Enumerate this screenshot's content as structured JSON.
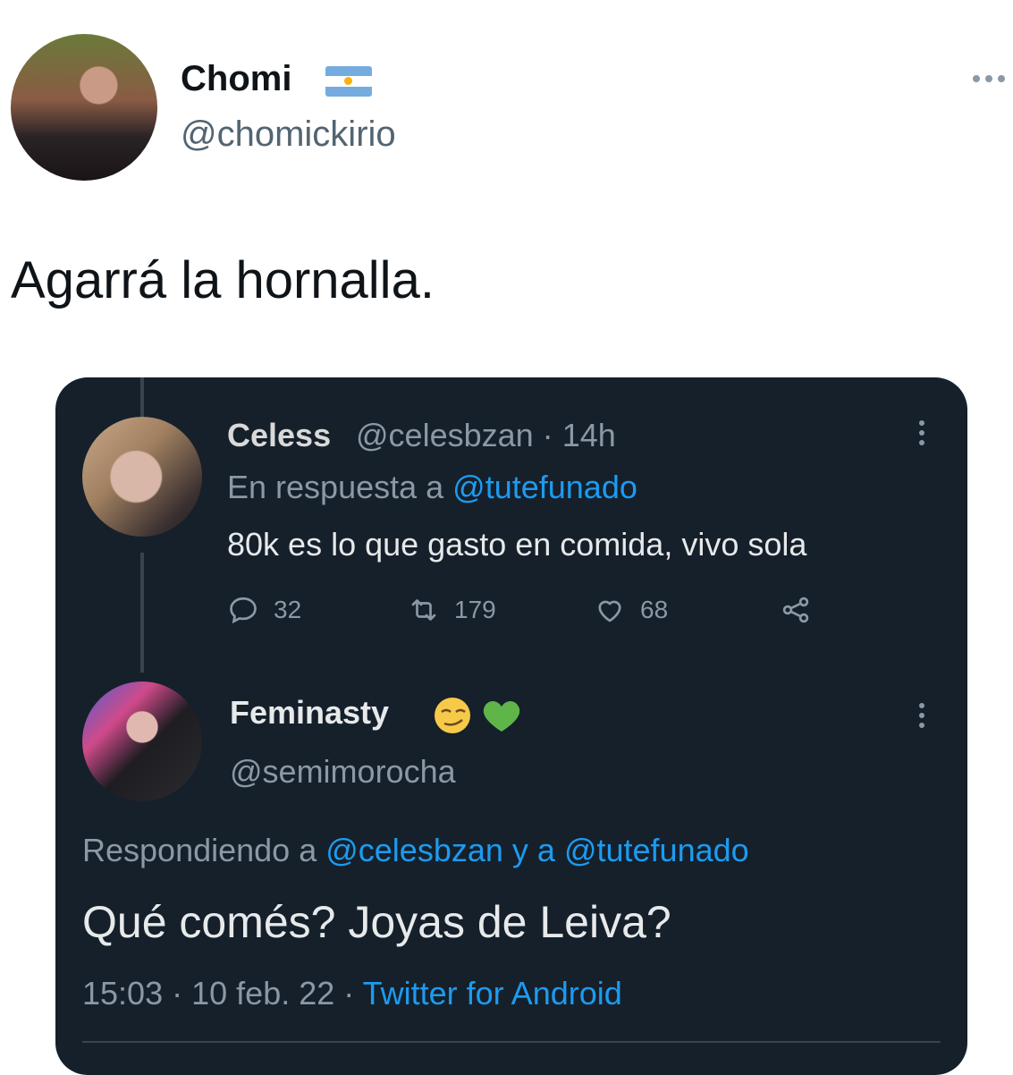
{
  "author": {
    "name": "Chomi",
    "handle": "@chomickirio",
    "flag_icon": "argentina-flag-icon"
  },
  "tweet": {
    "text": "Agarrá la hornalla."
  },
  "embedded": {
    "reply_tweet": {
      "name": "Celess",
      "handle": "@celesbzan",
      "time": "14h",
      "in_reply_label": "En respuesta a",
      "in_reply_to": "@tutefunado",
      "text": "80k es lo que gasto en comida, vivo sola",
      "replies": "32",
      "retweets": "179",
      "likes": "68"
    },
    "main_tweet": {
      "name": "Feminasty",
      "name_emojis": [
        "smirking-face-icon",
        "green-heart-icon"
      ],
      "handle": "@semimorocha",
      "replying_label": "Respondiendo a",
      "replying_to_1": "@celesbzan",
      "replying_conj": "y a",
      "replying_to_2": "@tutefunado",
      "text": "Qué comés? Joyas de Leiva?",
      "time": "15:03",
      "date": "10 feb. 22",
      "source": "Twitter for Android"
    }
  },
  "colors": {
    "link": "#1d9bf0",
    "dark_bg": "#15202b",
    "muted": "#8b98a5"
  }
}
